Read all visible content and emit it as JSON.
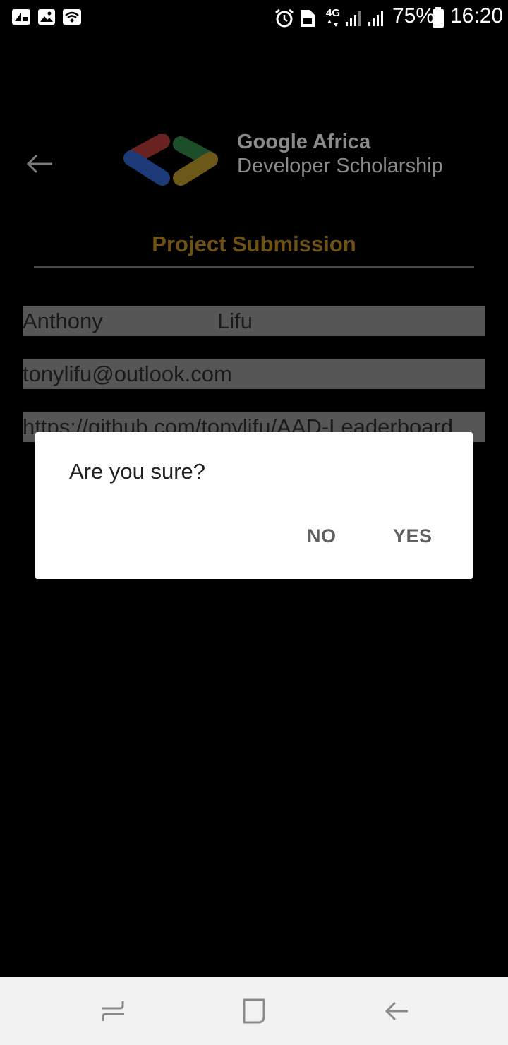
{
  "status_bar": {
    "left_icons": [
      "notification-app-icon",
      "gallery-icon",
      "wifi-icon"
    ],
    "right_icons": [
      "alarm-icon",
      "sim-icon",
      "signal-4g-icon",
      "signal-icon",
      "signal-icon",
      "battery-icon"
    ],
    "network_label": "4G",
    "battery": "75%",
    "time": "16:20"
  },
  "header": {
    "back_icon": "arrow-left-icon",
    "logo_line1": "Google Africa",
    "logo_line2": "Developer Scholarship",
    "logo_colors": [
      "#c23a31",
      "#2f62c0",
      "#1e7a40",
      "#b89424"
    ]
  },
  "form": {
    "title": "Project Submission",
    "first_name": "Anthony",
    "last_name": "Lifu",
    "email": "tonylifu@outlook.com",
    "github_link": "https://github.com/tonylifu/AAD-Leaderboard"
  },
  "dialog": {
    "message": "Are you sure?",
    "no_label": "NO",
    "yes_label": "YES"
  },
  "nav_bar": {
    "buttons": [
      "recent-apps-icon",
      "home-icon",
      "back-icon"
    ]
  },
  "colors": {
    "title_accent": "#6f5116",
    "scrim": "#000000",
    "dialog_bg": "#ffffff",
    "dialog_button_text": "#616161",
    "nav_bg": "#f2f2f2"
  }
}
